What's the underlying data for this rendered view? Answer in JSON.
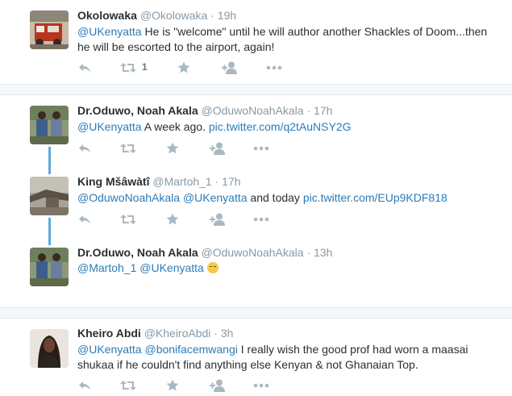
{
  "tweets": [
    {
      "name": "Okolowaka",
      "handle": "@Okolowaka",
      "sep": "·",
      "time": "19h",
      "segments": [
        {
          "t": "@UKenyatta",
          "link": true
        },
        {
          "t": " He is \"welcome\" until he will author another Shackles of Doom...then he will be escorted to the airport, again!",
          "link": false
        }
      ],
      "retweet_count": "1"
    },
    {
      "name": "Dr.Oduwo, Noah Akala",
      "handle": "@OduwoNoahAkala",
      "sep": "·",
      "time": "17h",
      "segments": [
        {
          "t": "@UKenyatta",
          "link": true
        },
        {
          "t": " A week ago. ",
          "link": false
        },
        {
          "t": "pic.twitter.com/q2tAuNSY2G",
          "link": true
        }
      ]
    },
    {
      "name": "King Mšâwàtî",
      "handle": "@Martoh_1",
      "sep": "·",
      "time": "17h",
      "segments": [
        {
          "t": "@OduwoNoahAkala",
          "link": true
        },
        {
          "t": " ",
          "link": false
        },
        {
          "t": "@UKenyatta",
          "link": true
        },
        {
          "t": " and today ",
          "link": false
        },
        {
          "t": "pic.twitter.com/EUp9KDF818",
          "link": true
        }
      ]
    },
    {
      "name": "Dr.Oduwo, Noah Akala",
      "handle": "@OduwoNoahAkala",
      "sep": "·",
      "time": "13h",
      "segments": [
        {
          "t": "@Martoh_1",
          "link": true
        },
        {
          "t": " ",
          "link": false
        },
        {
          "t": "@UKenyatta",
          "link": true
        },
        {
          "t": " ",
          "link": false
        }
      ],
      "emoji": "sleepy-face-emoji"
    },
    {
      "name": "Kheiro Abdi",
      "handle": "@KheiroAbdi",
      "sep": "·",
      "time": "3h",
      "segments": [
        {
          "t": "@UKenyatta",
          "link": true
        },
        {
          "t": " ",
          "link": false
        },
        {
          "t": "@bonifacemwangi",
          "link": true
        },
        {
          "t": " I really wish the good prof had worn a maasai shukaa if he couldn't find anything else Kenyan & not Ghanaian Top.",
          "link": false
        }
      ]
    }
  ],
  "colors": {
    "link": "#2b7bb9",
    "muted": "#8899a6",
    "action_icon": "#aab8c2",
    "thread_line": "#5ea9dd",
    "separator_bg": "#f5f8fa"
  },
  "icons": [
    "reply-icon",
    "retweet-icon",
    "favorite-star-icon",
    "follow-user-icon",
    "more-dots-icon"
  ]
}
